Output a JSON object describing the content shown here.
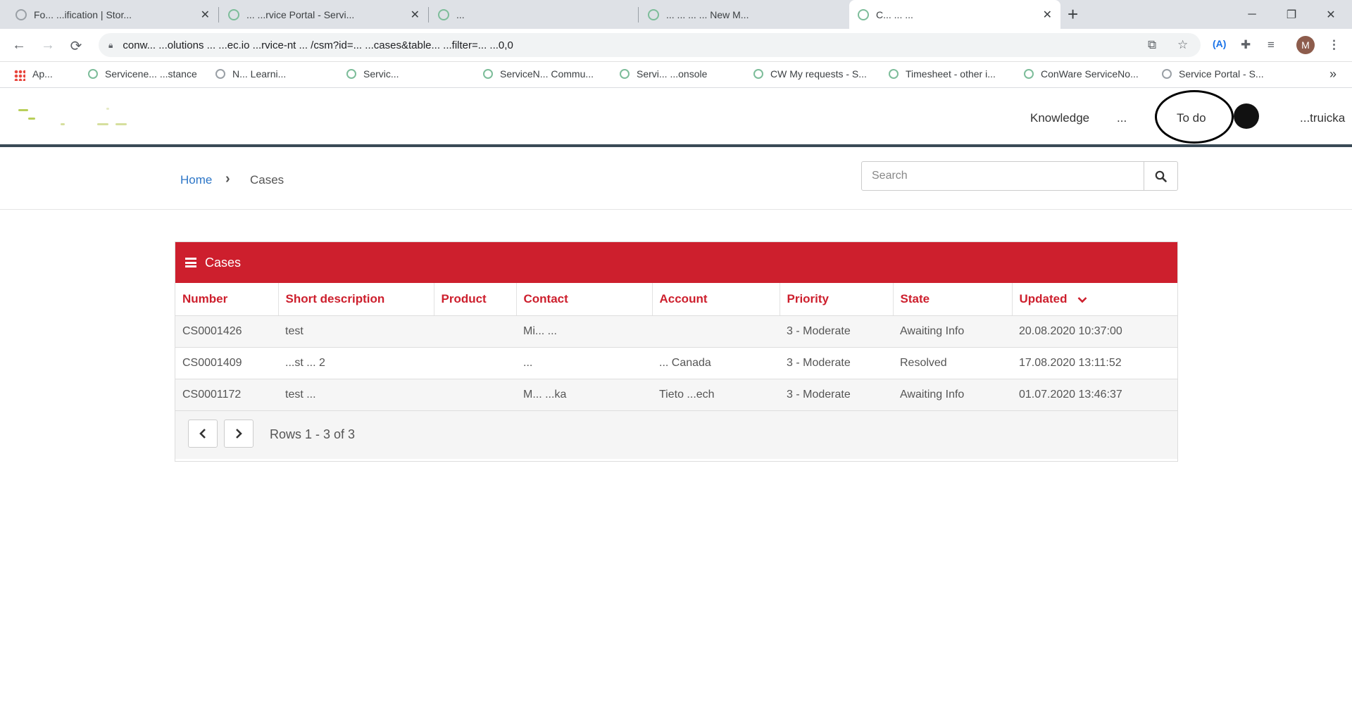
{
  "browser": {
    "tabs": [
      {
        "title": "Fo... ...ification | Stor..."
      },
      {
        "title": "... ...rvice Portal - Servi..."
      },
      {
        "title": "..."
      },
      {
        "title": "... ... ... ... New M..."
      },
      {
        "title": "C... ... ..."
      }
    ],
    "address": "conw... ...olutions ... ...ec.io ...rvice-nt ... /csm?id=... ...cases&table... ...filter=... ...0,0",
    "profile_initial": "M",
    "bookmarks": [
      {
        "label": "Ap..."
      },
      {
        "label": "Servicene... ...stance"
      },
      {
        "label": "N... Learni..."
      },
      {
        "label": "Servic..."
      },
      {
        "label": "ServiceN... Commu..."
      },
      {
        "label": "Servi... ...onsole"
      },
      {
        "label": "CW My requests - S..."
      },
      {
        "label": "Timesheet - other i..."
      },
      {
        "label": "ConWare ServiceNo..."
      },
      {
        "label": "Service Portal - S..."
      }
    ]
  },
  "portal": {
    "nav": [
      {
        "label": "Knowledge"
      },
      {
        "label": "..."
      },
      {
        "label": "To do"
      },
      {
        "label": "...truicka"
      }
    ]
  },
  "breadcrumb": {
    "home": "Home",
    "current": "Cases"
  },
  "search": {
    "placeholder": "Search"
  },
  "cases": {
    "title": "Cases",
    "columns": [
      "Number",
      "Short description",
      "Product",
      "Contact",
      "Account",
      "Priority",
      "State",
      "Updated"
    ],
    "rows": [
      {
        "number": "CS0001426",
        "short_description": "test",
        "product": "",
        "contact": "Mi... ...",
        "account": "",
        "priority": "3 - Moderate",
        "state": "Awaiting Info",
        "updated": "20.08.2020 10:37:00"
      },
      {
        "number": "CS0001409",
        "short_description": "...st ... 2",
        "product": "",
        "contact": "...",
        "account": "... Canada",
        "priority": "3 - Moderate",
        "state": "Resolved",
        "updated": "17.08.2020 13:11:52"
      },
      {
        "number": "CS0001172",
        "short_description": "test ...",
        "product": "",
        "contact": "M... ...ka",
        "account": "Tieto ...ech",
        "priority": "3 - Moderate",
        "state": "Awaiting Info",
        "updated": "01.07.2020 13:46:37"
      }
    ],
    "rows_info": "Rows 1 - 3 of 3"
  },
  "colors": {
    "brand_red": "#cd1f2d",
    "link_blue": "#2d76c7",
    "header_rule": "#3a4a56"
  }
}
